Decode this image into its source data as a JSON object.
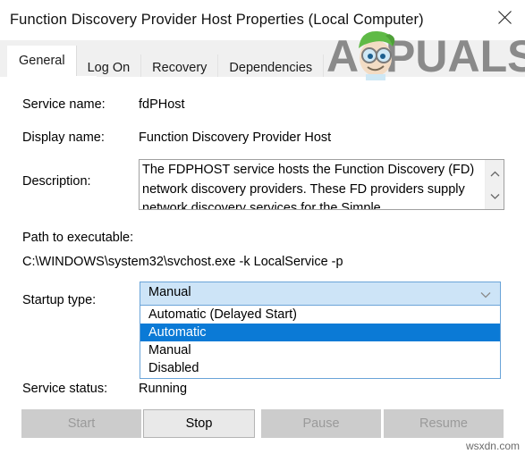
{
  "window": {
    "title": "Function Discovery Provider Host Properties (Local Computer)",
    "close_icon": "close-icon"
  },
  "tabs": [
    {
      "label": "General",
      "active": true
    },
    {
      "label": "Log On",
      "active": false
    },
    {
      "label": "Recovery",
      "active": false
    },
    {
      "label": "Dependencies",
      "active": false
    }
  ],
  "brand": {
    "name": "APPUALS",
    "text_left": "A",
    "text_right": "PUALS",
    "hat_color": "#5fba46",
    "text_color": "#8a8a8a"
  },
  "general": {
    "service_name_label": "Service name:",
    "service_name_value": "fdPHost",
    "display_name_label": "Display name:",
    "display_name_value": "Function Discovery Provider Host",
    "description_label": "Description:",
    "description_value": "The FDPHOST service hosts the Function Discovery (FD) network discovery providers. These FD providers supply network discovery services for the Simple",
    "path_label": "Path to executable:",
    "path_value": "C:\\WINDOWS\\system32\\svchost.exe -k LocalService -p",
    "startup_type_label": "Startup type:",
    "startup_type_value": "Manual",
    "service_status_label": "Service status:",
    "service_status_value": "Running"
  },
  "startup_dropdown": {
    "open": true,
    "selected": "Automatic",
    "highlight_color": "#0b7ad6",
    "options": [
      {
        "label": "Automatic (Delayed Start)",
        "selected": false
      },
      {
        "label": "Automatic",
        "selected": true
      },
      {
        "label": "Manual",
        "selected": false
      },
      {
        "label": "Disabled",
        "selected": false
      }
    ]
  },
  "action_buttons": [
    {
      "label": "Start",
      "enabled": false
    },
    {
      "label": "Stop",
      "enabled": true
    },
    {
      "label": "Pause",
      "enabled": false
    },
    {
      "label": "Resume",
      "enabled": false
    }
  ],
  "scrollbar": {
    "up_icon": "chevron-up-icon",
    "down_icon": "chevron-down-icon"
  },
  "watermark": "wsxdn.com"
}
